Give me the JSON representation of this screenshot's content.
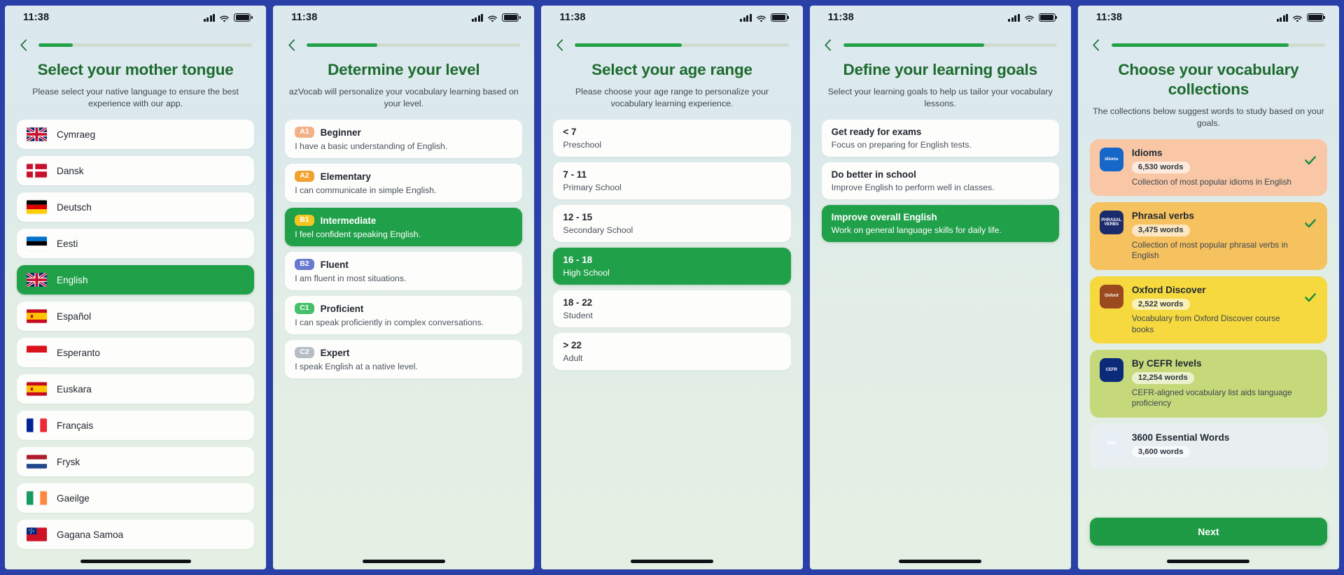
{
  "status": {
    "time": "11:38",
    "signal_icon": "cellular-signal-icon",
    "wifi_icon": "wifi-icon",
    "battery_icon": "battery-icon"
  },
  "screens": [
    {
      "id": "mother-tongue",
      "progress": 16,
      "title": "Select your mother tongue",
      "subtitle": "Please select your native language to ensure the best experience with our app.",
      "items": [
        {
          "label": "Cymraeg",
          "flag": "uk",
          "selected": false
        },
        {
          "label": "Dansk",
          "flag": "dk",
          "selected": false
        },
        {
          "label": "Deutsch",
          "flag": "de",
          "selected": false
        },
        {
          "label": "Eesti",
          "flag": "ee",
          "selected": false
        },
        {
          "label": "English",
          "flag": "uk",
          "selected": true
        },
        {
          "label": "Español",
          "flag": "es",
          "selected": false
        },
        {
          "label": "Esperanto",
          "flag": "eo",
          "selected": false
        },
        {
          "label": "Euskara",
          "flag": "es",
          "selected": false
        },
        {
          "label": "Français",
          "flag": "fr",
          "selected": false
        },
        {
          "label": "Frysk",
          "flag": "fy",
          "selected": false
        },
        {
          "label": "Gaeilge",
          "flag": "ie",
          "selected": false
        },
        {
          "label": "Gagana Samoa",
          "flag": "ws",
          "selected": false
        }
      ]
    },
    {
      "id": "determine-level",
      "progress": 33,
      "title": "Determine your level",
      "subtitle": "azVocab will personalize your vocabulary learning based on your level.",
      "items": [
        {
          "code": "A1",
          "code_color": "#f3b188",
          "label": "Beginner",
          "desc": "I have a basic understanding of English.",
          "selected": false
        },
        {
          "code": "A2",
          "code_color": "#f2a02e",
          "label": "Elementary",
          "desc": "I can communicate in simple English.",
          "selected": false
        },
        {
          "code": "B1",
          "code_color": "#f3c521",
          "label": "Intermediate",
          "desc": "I feel confident speaking English.",
          "selected": true
        },
        {
          "code": "B2",
          "code_color": "#6a79d0",
          "label": "Fluent",
          "desc": "I am fluent in most situations.",
          "selected": false
        },
        {
          "code": "C1",
          "code_color": "#44c06a",
          "label": "Proficient",
          "desc": "I can speak proficiently in complex conversations.",
          "selected": false
        },
        {
          "code": "C2",
          "code_color": "#b6bdc4",
          "label": "Expert",
          "desc": "I speak English at a native level.",
          "selected": false
        }
      ]
    },
    {
      "id": "age-range",
      "progress": 50,
      "title": "Select your age range",
      "subtitle": "Please choose your age range to personalize your vocabulary learning experience.",
      "items": [
        {
          "label": "< 7",
          "sub": "Preschool",
          "selected": false
        },
        {
          "label": "7 - 11",
          "sub": "Primary School",
          "selected": false
        },
        {
          "label": "12 - 15",
          "sub": "Secondary School",
          "selected": false
        },
        {
          "label": "16 - 18",
          "sub": "High School",
          "selected": true
        },
        {
          "label": "18 - 22",
          "sub": "Student",
          "selected": false
        },
        {
          "label": "> 22",
          "sub": "Adult",
          "selected": false
        }
      ]
    },
    {
      "id": "learning-goals",
      "progress": 66,
      "title": "Define your learning goals",
      "subtitle": "Select your learning goals to help us tailor your vocabulary lessons.",
      "items": [
        {
          "label": "Get ready for exams",
          "sub": "Focus on preparing for English tests.",
          "selected": false
        },
        {
          "label": "Do better in school",
          "sub": "Improve English to perform well in classes.",
          "selected": false
        },
        {
          "label": "Improve overall English",
          "sub": "Work on general language skills for daily life.",
          "selected": true
        }
      ]
    },
    {
      "id": "vocabulary-collections",
      "progress": 83,
      "title": "Choose your vocabulary collections",
      "subtitle": "The collections below suggest words to study based on your goals.",
      "next_label": "Next",
      "items": [
        {
          "title": "Idioms",
          "count": "6,530 words",
          "desc": "Collection of most popular idioms in English",
          "bg": "#f9c7a5",
          "thumb_bg": "#1667c8",
          "thumb_text": "idioms",
          "checked": true
        },
        {
          "title": "Phrasal verbs",
          "count": "3,475 words",
          "desc": "Collection of most popular phrasal verbs in English",
          "bg": "#f6c15f",
          "thumb_bg": "#1a2a6b",
          "thumb_text": "PHRASAL VERBS",
          "checked": true
        },
        {
          "title": "Oxford Discover",
          "count": "2,522 words",
          "desc": "Vocabulary from Oxford Discover course books",
          "bg": "#f5d93f",
          "thumb_bg": "#9b4a20",
          "thumb_text": "Oxford",
          "checked": true
        },
        {
          "title": "By CEFR levels",
          "count": "12,254 words",
          "desc": "CEFR-aligned vocabulary list aids language proficiency",
          "bg": "#c6d97a",
          "thumb_bg": "#0c2a7a",
          "thumb_text": "CEFR",
          "checked": false
        },
        {
          "title": "3600 Essential Words",
          "count": "3,600 words",
          "desc": "",
          "bg": "#e9eef1",
          "thumb_bg": "#e8eef5",
          "thumb_text": "4000",
          "checked": false
        }
      ]
    }
  ]
}
